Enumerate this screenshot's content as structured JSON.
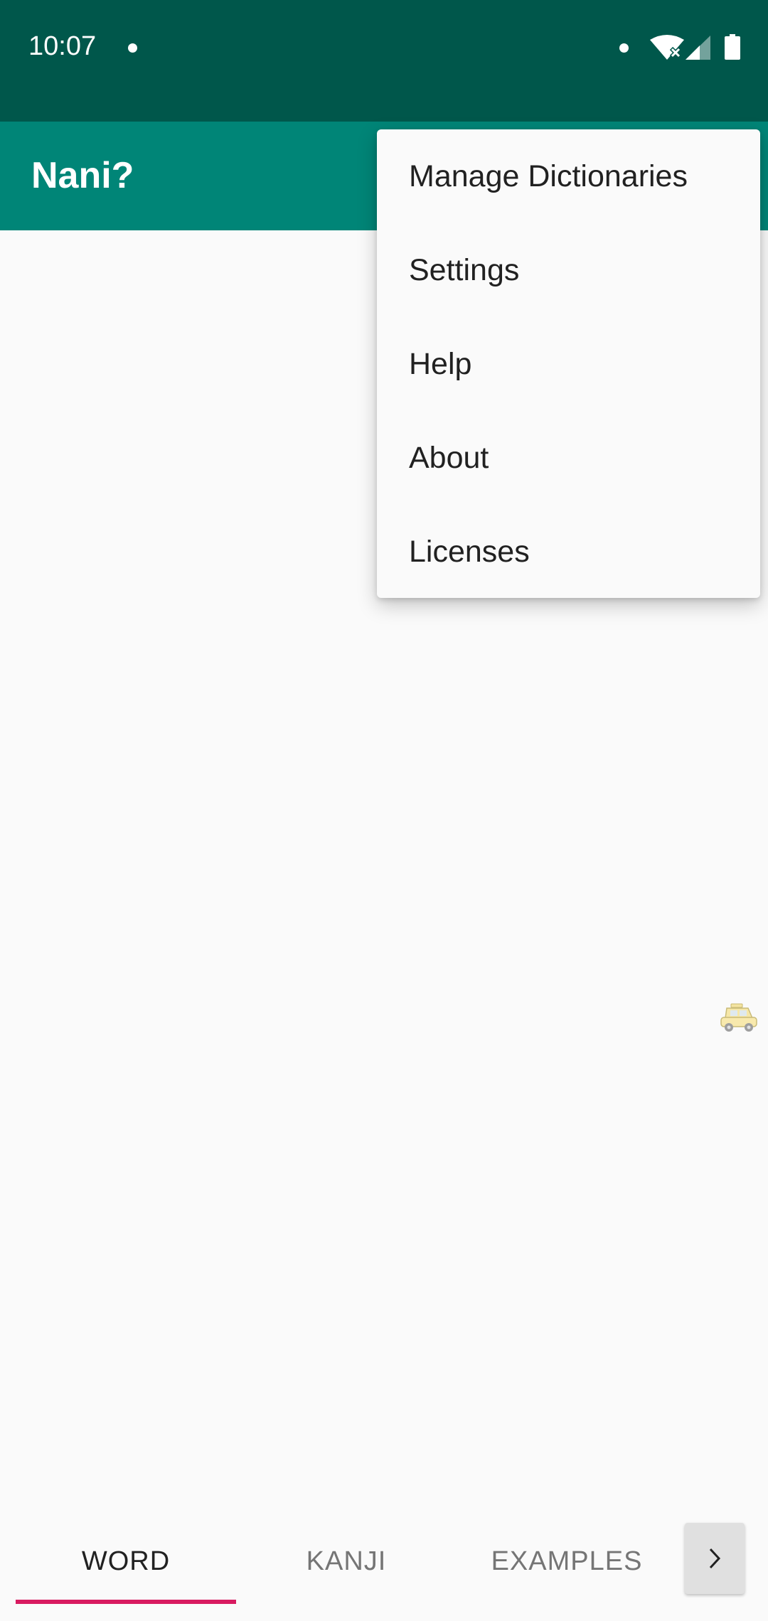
{
  "status_bar": {
    "time": "10:07",
    "icons": [
      "notification-dot",
      "wifi-icon",
      "cell-signal-icon",
      "battery-icon"
    ]
  },
  "app_bar": {
    "title": "Nani?"
  },
  "overflow_menu": {
    "items": [
      {
        "label": "Manage Dictionaries"
      },
      {
        "label": "Settings"
      },
      {
        "label": "Help"
      },
      {
        "label": "About"
      },
      {
        "label": "Licenses"
      }
    ]
  },
  "tabs": [
    {
      "label": "WORD",
      "active": true
    },
    {
      "label": "KANJI",
      "active": false
    },
    {
      "label": "EXAMPLES",
      "active": false
    }
  ],
  "colors": {
    "status_bar": "#00574b",
    "app_bar": "#008577",
    "tab_indicator": "#d81b60",
    "background": "#fafafa"
  }
}
